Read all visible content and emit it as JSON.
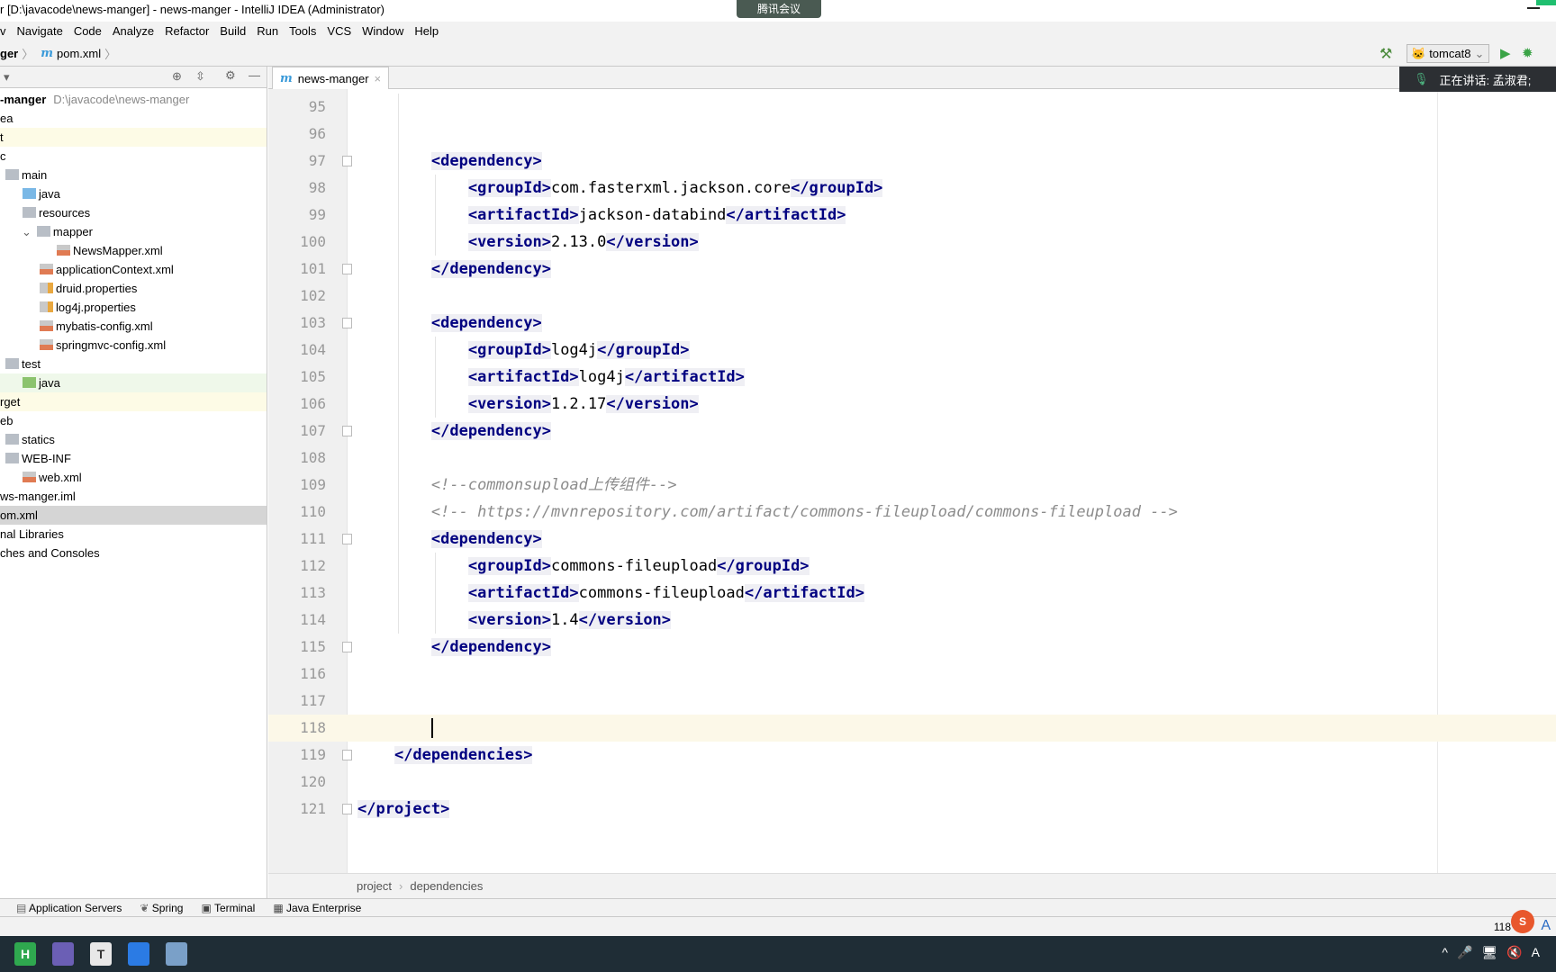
{
  "window": {
    "title": "r [D:\\javacode\\news-manger] - news-manger - IntelliJ IDEA (Administrator)",
    "meeting_badge": "腾讯会议"
  },
  "menu": [
    "v",
    "Navigate",
    "Code",
    "Analyze",
    "Refactor",
    "Build",
    "Run",
    "Tools",
    "VCS",
    "Window",
    "Help"
  ],
  "nav": {
    "project": "ger",
    "file_icon": "m",
    "file": "pom.xml"
  },
  "toolbar": {
    "run_config": "tomcat8",
    "build_icon": "hammer-icon",
    "run_icon": "play-icon",
    "debug_icon": "bug-icon"
  },
  "speaking": {
    "text": "正在讲话: 孟淑君;"
  },
  "tab": {
    "icon": "m",
    "label": "news-manger",
    "close": "×"
  },
  "tree": [
    {
      "label": "-manger",
      "path": "D:\\javacode\\news-manger",
      "icon": "",
      "bold": true,
      "indent": 0,
      "bg": ""
    },
    {
      "label": "ea",
      "icon": "",
      "indent": 0,
      "bg": ""
    },
    {
      "label": "t",
      "icon": "",
      "indent": 0,
      "bg": "#fdfbe6"
    },
    {
      "label": "c",
      "icon": "",
      "indent": 0,
      "bg": ""
    },
    {
      "label": "main",
      "icon": "folder",
      "indent": 0,
      "bg": ""
    },
    {
      "label": "java",
      "icon": "folder-blue",
      "indent": 1,
      "bg": ""
    },
    {
      "label": "resources",
      "icon": "folder",
      "indent": 1,
      "bg": ""
    },
    {
      "label": "mapper",
      "icon": "folder",
      "indent": 2,
      "bg": "",
      "chevron": "⌄"
    },
    {
      "label": "NewsMapper.xml",
      "icon": "xml",
      "indent": 3,
      "bg": ""
    },
    {
      "label": "applicationContext.xml",
      "icon": "xml",
      "indent": 2,
      "bg": ""
    },
    {
      "label": "druid.properties",
      "icon": "prop",
      "indent": 2,
      "bg": ""
    },
    {
      "label": "log4j.properties",
      "icon": "prop",
      "indent": 2,
      "bg": ""
    },
    {
      "label": "mybatis-config.xml",
      "icon": "xml",
      "indent": 2,
      "bg": ""
    },
    {
      "label": "springmvc-config.xml",
      "icon": "xml",
      "indent": 2,
      "bg": ""
    },
    {
      "label": "test",
      "icon": "folder",
      "indent": 0,
      "bg": ""
    },
    {
      "label": "java",
      "icon": "folder-green",
      "indent": 1,
      "bg": "#eff8ea"
    },
    {
      "label": "rget",
      "icon": "",
      "indent": 0,
      "bg": "#fdfbe6"
    },
    {
      "label": "eb",
      "icon": "",
      "indent": 0,
      "bg": ""
    },
    {
      "label": "statics",
      "icon": "folder",
      "indent": 0,
      "bg": ""
    },
    {
      "label": "WEB-INF",
      "icon": "folder",
      "indent": 0,
      "bg": ""
    },
    {
      "label": "web.xml",
      "icon": "xml",
      "indent": 1,
      "bg": ""
    },
    {
      "label": "ws-manger.iml",
      "icon": "",
      "indent": 0,
      "bg": ""
    },
    {
      "label": "om.xml",
      "icon": "",
      "indent": 0,
      "bg": "#d5d5d5"
    },
    {
      "label": "nal Libraries",
      "icon": "",
      "indent": 0,
      "bg": ""
    },
    {
      "label": "ches and Consoles",
      "icon": "",
      "indent": 0,
      "bg": ""
    }
  ],
  "editor": {
    "current_line": "118",
    "lines": [
      {
        "n": "95",
        "s": []
      },
      {
        "n": "96",
        "s": []
      },
      {
        "n": "97",
        "fold": true,
        "s": [
          {
            "k": "ws",
            "t": "        "
          },
          {
            "k": "tag",
            "t": "<dependency>"
          }
        ]
      },
      {
        "n": "98",
        "s": [
          {
            "k": "ws",
            "t": "            "
          },
          {
            "k": "tag",
            "t": "<groupId>"
          },
          {
            "k": "txt",
            "t": "com.fasterxml.jackson.core"
          },
          {
            "k": "tag",
            "t": "</groupId>"
          }
        ]
      },
      {
        "n": "99",
        "s": [
          {
            "k": "ws",
            "t": "            "
          },
          {
            "k": "tag",
            "t": "<artifactId>"
          },
          {
            "k": "txt",
            "t": "jackson-databind"
          },
          {
            "k": "tag",
            "t": "</artifactId>"
          }
        ]
      },
      {
        "n": "100",
        "s": [
          {
            "k": "ws",
            "t": "            "
          },
          {
            "k": "tag",
            "t": "<version>"
          },
          {
            "k": "txt",
            "t": "2.13.0"
          },
          {
            "k": "tag",
            "t": "</version>"
          }
        ]
      },
      {
        "n": "101",
        "fold": true,
        "s": [
          {
            "k": "ws",
            "t": "        "
          },
          {
            "k": "tag",
            "t": "</dependency>"
          }
        ]
      },
      {
        "n": "102",
        "s": []
      },
      {
        "n": "103",
        "fold": true,
        "s": [
          {
            "k": "ws",
            "t": "        "
          },
          {
            "k": "tag",
            "t": "<dependency>"
          }
        ]
      },
      {
        "n": "104",
        "s": [
          {
            "k": "ws",
            "t": "            "
          },
          {
            "k": "tag",
            "t": "<groupId>"
          },
          {
            "k": "txt",
            "t": "log4j"
          },
          {
            "k": "tag",
            "t": "</groupId>"
          }
        ]
      },
      {
        "n": "105",
        "s": [
          {
            "k": "ws",
            "t": "            "
          },
          {
            "k": "tag",
            "t": "<artifactId>"
          },
          {
            "k": "txt",
            "t": "log4j"
          },
          {
            "k": "tag",
            "t": "</artifactId>"
          }
        ]
      },
      {
        "n": "106",
        "s": [
          {
            "k": "ws",
            "t": "            "
          },
          {
            "k": "tag",
            "t": "<version>"
          },
          {
            "k": "txt",
            "t": "1.2.17"
          },
          {
            "k": "tag",
            "t": "</version>"
          }
        ]
      },
      {
        "n": "107",
        "fold": true,
        "s": [
          {
            "k": "ws",
            "t": "        "
          },
          {
            "k": "tag",
            "t": "</dependency>"
          }
        ]
      },
      {
        "n": "108",
        "s": []
      },
      {
        "n": "109",
        "s": [
          {
            "k": "ws",
            "t": "        "
          },
          {
            "k": "cmt",
            "t": "<!--commonsupload上传组件-->"
          }
        ]
      },
      {
        "n": "110",
        "s": [
          {
            "k": "ws",
            "t": "        "
          },
          {
            "k": "cmt",
            "t": "<!-- https://mvnrepository.com/artifact/commons-fileupload/commons-fileupload -->"
          }
        ]
      },
      {
        "n": "111",
        "fold": true,
        "s": [
          {
            "k": "ws",
            "t": "        "
          },
          {
            "k": "tag",
            "t": "<dependency>"
          }
        ]
      },
      {
        "n": "112",
        "s": [
          {
            "k": "ws",
            "t": "            "
          },
          {
            "k": "tag",
            "t": "<groupId>"
          },
          {
            "k": "txt",
            "t": "commons-fileupload"
          },
          {
            "k": "tag",
            "t": "</groupId>"
          }
        ]
      },
      {
        "n": "113",
        "s": [
          {
            "k": "ws",
            "t": "            "
          },
          {
            "k": "tag",
            "t": "<artifactId>"
          },
          {
            "k": "txt",
            "t": "commons-fileupload"
          },
          {
            "k": "tag",
            "t": "</artifactId>"
          }
        ]
      },
      {
        "n": "114",
        "s": [
          {
            "k": "ws",
            "t": "            "
          },
          {
            "k": "tag",
            "t": "<version>"
          },
          {
            "k": "txt",
            "t": "1.4"
          },
          {
            "k": "tag",
            "t": "</version>"
          }
        ]
      },
      {
        "n": "115",
        "fold": true,
        "s": [
          {
            "k": "ws",
            "t": "        "
          },
          {
            "k": "tag",
            "t": "</dependency>"
          }
        ]
      },
      {
        "n": "116",
        "s": []
      },
      {
        "n": "117",
        "s": []
      },
      {
        "n": "118",
        "caret": true,
        "s": [
          {
            "k": "ws",
            "t": "        "
          }
        ]
      },
      {
        "n": "119",
        "fold": true,
        "s": [
          {
            "k": "ws",
            "t": "    "
          },
          {
            "k": "tag",
            "t": "</dependencies>"
          }
        ]
      },
      {
        "n": "120",
        "s": []
      },
      {
        "n": "121",
        "fold": true,
        "s": [
          {
            "k": "tag",
            "t": "</project>"
          }
        ]
      }
    ]
  },
  "breadcrumb": [
    "project",
    "dependencies"
  ],
  "tool_tabs": [
    "Application Servers",
    "Spring",
    "Terminal",
    "Java Enterprise"
  ],
  "status": {
    "position": "118",
    "ime": "S",
    "ime_mode": "A"
  },
  "taskbar": {
    "apps": [
      {
        "label": "H",
        "color": "#2fa84f"
      },
      {
        "label": "",
        "color": "#6b5fb5"
      },
      {
        "label": "T",
        "color": "#e8e8e8"
      },
      {
        "label": "",
        "color": "#2b7be4"
      },
      {
        "label": "",
        "color": "#7aa0c8"
      }
    ],
    "tray": [
      "^",
      "🎤",
      "🖥",
      "🔇",
      "A"
    ]
  },
  "colors": {
    "tag": "#000080",
    "comment": "#8c8c8c",
    "current_line": "#fcf8e8",
    "accent": "#3a9ad9"
  }
}
